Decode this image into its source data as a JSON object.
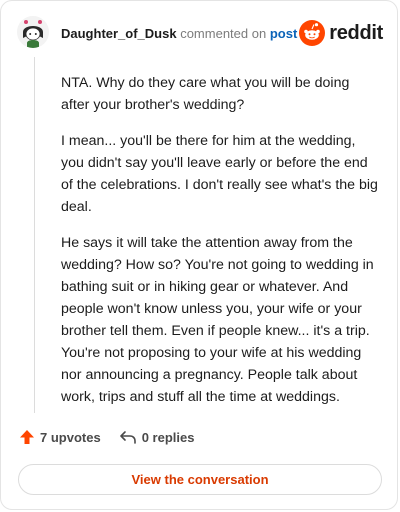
{
  "header": {
    "username": "Daughter_of_Dusk",
    "action_text": "commented on",
    "post_link": "post",
    "brand_name": "reddit"
  },
  "comment": {
    "paragraphs": [
      "NTA. Why do they care what you will be doing after your brother's wedding?",
      "I mean... you'll be there for him at the wedding, you didn't say you'll leave early or before the end of the celebrations. I don't really see what's the big deal.",
      "He says it will take the attention away from the wedding? How so? You're not going to wedding in bathing suit or in hiking gear or whatever. And people won't know unless you, your wife or your brother tell them. Even if people knew... it's a trip. You're not proposing to your wife at his wedding nor announcing a pregnancy. People talk about work, trips and stuff all the time at weddings."
    ]
  },
  "footer": {
    "upvotes_label": "7 upvotes",
    "replies_label": "0 replies",
    "view_button_label": "View the conversation"
  },
  "colors": {
    "brand_orange": "#ff4500",
    "link_blue": "#0b63b8",
    "button_text": "#d93a00"
  },
  "icons": {
    "avatar": "snoo-avatar-icon",
    "brand": "reddit-logo-icon",
    "upvote": "upvote-arrow-icon",
    "reply": "reply-arrow-icon"
  }
}
